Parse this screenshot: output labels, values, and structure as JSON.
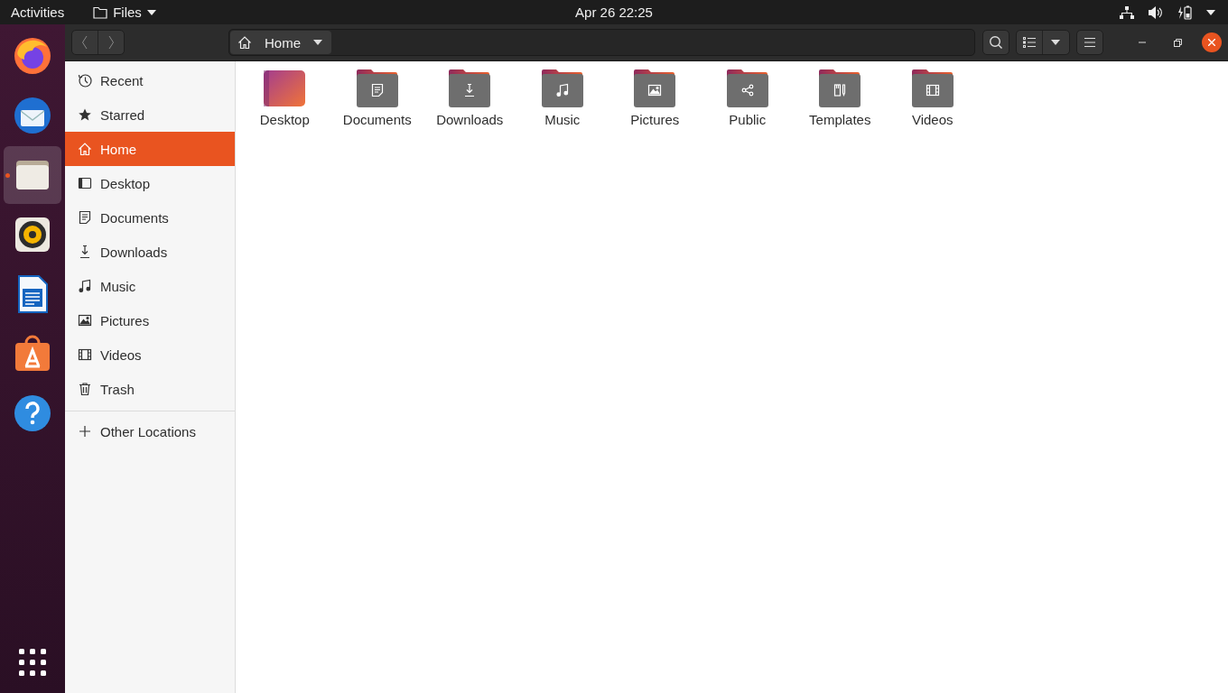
{
  "top_bar": {
    "activities": "Activities",
    "app_menu": "Files",
    "clock": "Apr 26  22:25"
  },
  "dock": {
    "apps": [
      {
        "kind": "firefox",
        "selected": false
      },
      {
        "kind": "mail",
        "selected": false
      },
      {
        "kind": "files",
        "selected": true
      },
      {
        "kind": "music",
        "selected": false
      },
      {
        "kind": "writer",
        "selected": false
      },
      {
        "kind": "software",
        "selected": false
      },
      {
        "kind": "help",
        "selected": false
      }
    ]
  },
  "header": {
    "location": "Home"
  },
  "sidebar": {
    "items": [
      {
        "kind": "recent",
        "label": "Recent",
        "selected": false
      },
      {
        "kind": "starred",
        "label": "Starred",
        "selected": false
      },
      {
        "kind": "home",
        "label": "Home",
        "selected": true
      },
      {
        "kind": "desktop",
        "label": "Desktop",
        "selected": false
      },
      {
        "kind": "documents",
        "label": "Documents",
        "selected": false
      },
      {
        "kind": "downloads",
        "label": "Downloads",
        "selected": false
      },
      {
        "kind": "music",
        "label": "Music",
        "selected": false
      },
      {
        "kind": "pictures",
        "label": "Pictures",
        "selected": false
      },
      {
        "kind": "videos",
        "label": "Videos",
        "selected": false
      },
      {
        "kind": "trash",
        "label": "Trash",
        "selected": false
      }
    ],
    "other_locations": "Other Locations"
  },
  "files": [
    {
      "kind": "desktop",
      "name": "Desktop"
    },
    {
      "kind": "documents",
      "name": "Documents"
    },
    {
      "kind": "downloads",
      "name": "Downloads"
    },
    {
      "kind": "music",
      "name": "Music"
    },
    {
      "kind": "pictures",
      "name": "Pictures"
    },
    {
      "kind": "public",
      "name": "Public"
    },
    {
      "kind": "templates",
      "name": "Templates"
    },
    {
      "kind": "videos",
      "name": "Videos"
    }
  ]
}
